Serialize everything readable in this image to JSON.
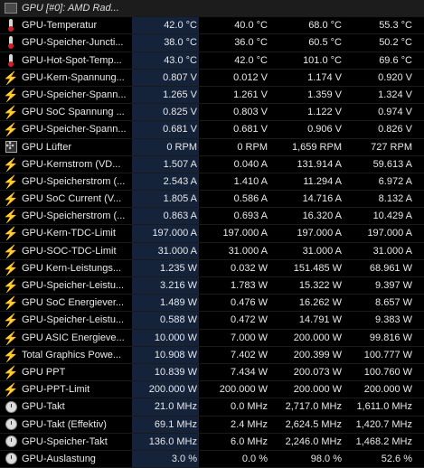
{
  "header": {
    "title": "GPU [#0]: AMD Rad..."
  },
  "rows": [
    {
      "icon": "thermometer-icon",
      "name": "GPU-Temperatur",
      "cur": "42.0 °C",
      "min": "40.0 °C",
      "max": "68.0 °C",
      "avg": "55.3 °C"
    },
    {
      "icon": "thermometer-icon",
      "name": "GPU-Speicher-Juncti...",
      "cur": "38.0 °C",
      "min": "36.0 °C",
      "max": "60.5 °C",
      "avg": "50.2 °C"
    },
    {
      "icon": "thermometer-icon",
      "name": "GPU-Hot-Spot-Temp...",
      "cur": "43.0 °C",
      "min": "42.0 °C",
      "max": "101.0 °C",
      "avg": "69.6 °C"
    },
    {
      "icon": "lightning-icon",
      "name": "GPU-Kern-Spannung...",
      "cur": "0.807 V",
      "min": "0.012 V",
      "max": "1.174 V",
      "avg": "0.920 V"
    },
    {
      "icon": "lightning-icon",
      "name": "GPU-Speicher-Spann...",
      "cur": "1.265 V",
      "min": "1.261 V",
      "max": "1.359 V",
      "avg": "1.324 V"
    },
    {
      "icon": "lightning-icon",
      "name": "GPU SoC Spannung ...",
      "cur": "0.825 V",
      "min": "0.803 V",
      "max": "1.122 V",
      "avg": "0.974 V"
    },
    {
      "icon": "lightning-icon",
      "name": "GPU-Speicher-Spann...",
      "cur": "0.681 V",
      "min": "0.681 V",
      "max": "0.906 V",
      "avg": "0.826 V"
    },
    {
      "icon": "fan-icon",
      "name": "GPU Lüfter",
      "cur": "0 RPM",
      "min": "0 RPM",
      "max": "1,659 RPM",
      "avg": "727 RPM"
    },
    {
      "icon": "lightning-icon",
      "name": "GPU-Kernstrom (VD...",
      "cur": "1.507 A",
      "min": "0.040 A",
      "max": "131.914 A",
      "avg": "59.613 A"
    },
    {
      "icon": "lightning-icon",
      "name": "GPU-Speicherstrom (...",
      "cur": "2.543 A",
      "min": "1.410 A",
      "max": "11.294 A",
      "avg": "6.972 A"
    },
    {
      "icon": "lightning-icon",
      "name": "GPU SoC Current (V...",
      "cur": "1.805 A",
      "min": "0.586 A",
      "max": "14.716 A",
      "avg": "8.132 A"
    },
    {
      "icon": "lightning-icon",
      "name": "GPU-Speicherstrom (...",
      "cur": "0.863 A",
      "min": "0.693 A",
      "max": "16.320 A",
      "avg": "10.429 A"
    },
    {
      "icon": "lightning-icon",
      "name": "GPU-Kern-TDC-Limit",
      "cur": "197.000 A",
      "min": "197.000 A",
      "max": "197.000 A",
      "avg": "197.000 A"
    },
    {
      "icon": "lightning-icon",
      "name": "GPU-SOC-TDC-Limit",
      "cur": "31.000 A",
      "min": "31.000 A",
      "max": "31.000 A",
      "avg": "31.000 A"
    },
    {
      "icon": "lightning-icon",
      "name": "GPU Kern-Leistungs...",
      "cur": "1.235 W",
      "min": "0.032 W",
      "max": "151.485 W",
      "avg": "68.961 W"
    },
    {
      "icon": "lightning-icon",
      "name": "GPU-Speicher-Leistu...",
      "cur": "3.216 W",
      "min": "1.783 W",
      "max": "15.322 W",
      "avg": "9.397 W"
    },
    {
      "icon": "lightning-icon",
      "name": "GPU SoC Energiever...",
      "cur": "1.489 W",
      "min": "0.476 W",
      "max": "16.262 W",
      "avg": "8.657 W"
    },
    {
      "icon": "lightning-icon",
      "name": "GPU-Speicher-Leistu...",
      "cur": "0.588 W",
      "min": "0.472 W",
      "max": "14.791 W",
      "avg": "9.383 W"
    },
    {
      "icon": "lightning-icon",
      "name": "GPU ASIC Energieve...",
      "cur": "10.000 W",
      "min": "7.000 W",
      "max": "200.000 W",
      "avg": "99.816 W"
    },
    {
      "icon": "lightning-icon",
      "name": "Total Graphics Powe...",
      "cur": "10.908 W",
      "min": "7.402 W",
      "max": "200.399 W",
      "avg": "100.777 W"
    },
    {
      "icon": "lightning-icon",
      "name": "GPU PPT",
      "cur": "10.839 W",
      "min": "7.434 W",
      "max": "200.073 W",
      "avg": "100.760 W"
    },
    {
      "icon": "lightning-icon",
      "name": "GPU-PPT-Limit",
      "cur": "200.000 W",
      "min": "200.000 W",
      "max": "200.000 W",
      "avg": "200.000 W"
    },
    {
      "icon": "clock-icon",
      "name": "GPU-Takt",
      "cur": "21.0 MHz",
      "min": "0.0 MHz",
      "max": "2,717.0 MHz",
      "avg": "1,611.0 MHz"
    },
    {
      "icon": "clock-icon",
      "name": "GPU-Takt (Effektiv)",
      "cur": "69.1 MHz",
      "min": "2.4 MHz",
      "max": "2,624.5 MHz",
      "avg": "1,420.7 MHz"
    },
    {
      "icon": "clock-icon",
      "name": "GPU-Speicher-Takt",
      "cur": "136.0 MHz",
      "min": "6.0 MHz",
      "max": "2,246.0 MHz",
      "avg": "1,468.2 MHz"
    },
    {
      "icon": "clock-icon",
      "name": "GPU-Auslastung",
      "cur": "3.0 %",
      "min": "0.0 %",
      "max": "98.0 %",
      "avg": "52.6 %"
    }
  ]
}
